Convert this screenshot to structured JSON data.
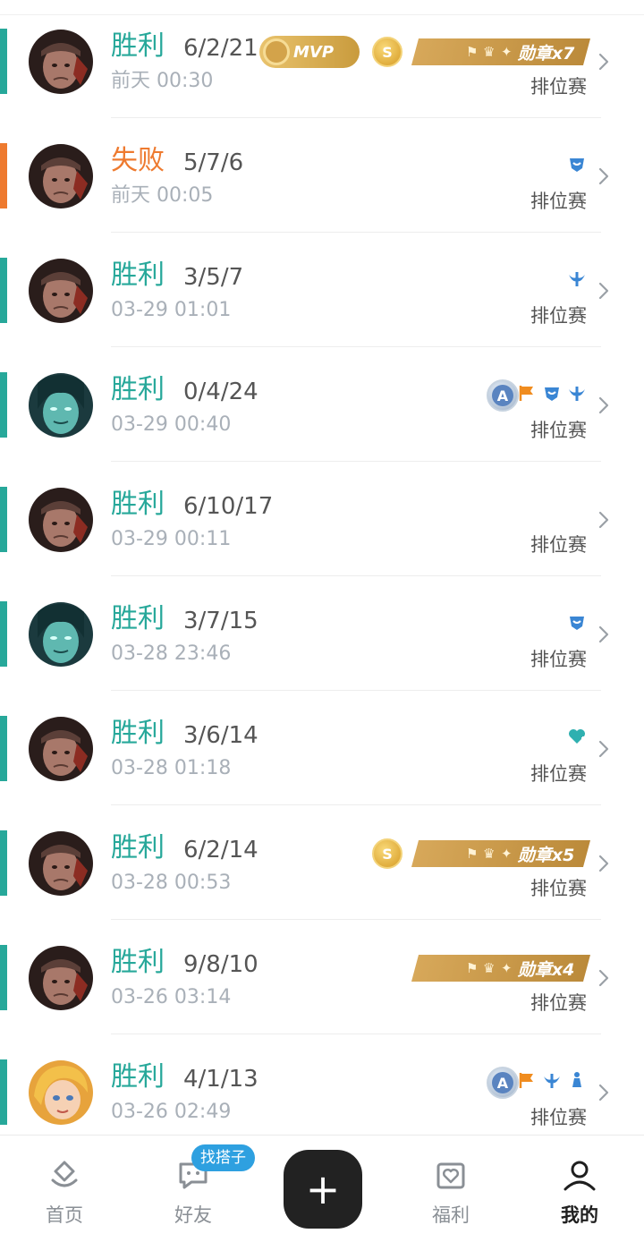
{
  "matches": [
    {
      "result": "胜利",
      "kda": "6/2/21",
      "time": "前天 00:30",
      "mode": "排位赛",
      "outcome": "win",
      "avatar": "warrior",
      "mvp": "MVP",
      "coin": "S",
      "ribbon": "勋章x7"
    },
    {
      "result": "失败",
      "kda": "5/7/6",
      "time": "前天 00:05",
      "mode": "排位赛",
      "outcome": "loss",
      "avatar": "warrior",
      "icons": [
        "blue-mask-icon"
      ]
    },
    {
      "result": "胜利",
      "kda": "3/5/7",
      "time": "03-29 01:01",
      "mode": "排位赛",
      "outcome": "win",
      "avatar": "warrior",
      "icons": [
        "blue-wing-icon"
      ]
    },
    {
      "result": "胜利",
      "kda": "0/4/24",
      "time": "03-29 00:40",
      "mode": "排位赛",
      "outcome": "win",
      "avatar": "ghost",
      "ace": "A",
      "icons": [
        "orange-flag-icon",
        "blue-mask-icon",
        "blue-wing-icon"
      ]
    },
    {
      "result": "胜利",
      "kda": "6/10/17",
      "time": "03-29 00:11",
      "mode": "排位赛",
      "outcome": "win",
      "avatar": "warrior"
    },
    {
      "result": "胜利",
      "kda": "3/7/15",
      "time": "03-28 23:46",
      "mode": "排位赛",
      "outcome": "win",
      "avatar": "ghost",
      "icons": [
        "blue-mask-icon"
      ]
    },
    {
      "result": "胜利",
      "kda": "3/6/14",
      "time": "03-28 01:18",
      "mode": "排位赛",
      "outcome": "win",
      "avatar": "warrior",
      "icons": [
        "teal-heart-icon"
      ]
    },
    {
      "result": "胜利",
      "kda": "6/2/14",
      "time": "03-28 00:53",
      "mode": "排位赛",
      "outcome": "win",
      "avatar": "warrior",
      "coin": "S",
      "ribbon": "勋章x5"
    },
    {
      "result": "胜利",
      "kda": "9/8/10",
      "time": "03-26 03:14",
      "mode": "排位赛",
      "outcome": "win",
      "avatar": "warrior",
      "ribbon": "勋章x4"
    },
    {
      "result": "胜利",
      "kda": "4/1/13",
      "time": "03-26 02:49",
      "mode": "排位赛",
      "outcome": "win",
      "avatar": "blonde",
      "ace": "A",
      "icons": [
        "orange-flag-icon",
        "blue-wing-icon",
        "blue-chess-icon"
      ]
    }
  ],
  "tabs": {
    "home": "首页",
    "friends": "好友",
    "friends_badge": "找搭子",
    "add": "+",
    "welfare": "福利",
    "mine": "我的"
  },
  "colors": {
    "win": "#27a89a",
    "loss": "#ee7a2f",
    "gold": "#c99b3d",
    "badge_blue": "#2ea0e0"
  }
}
